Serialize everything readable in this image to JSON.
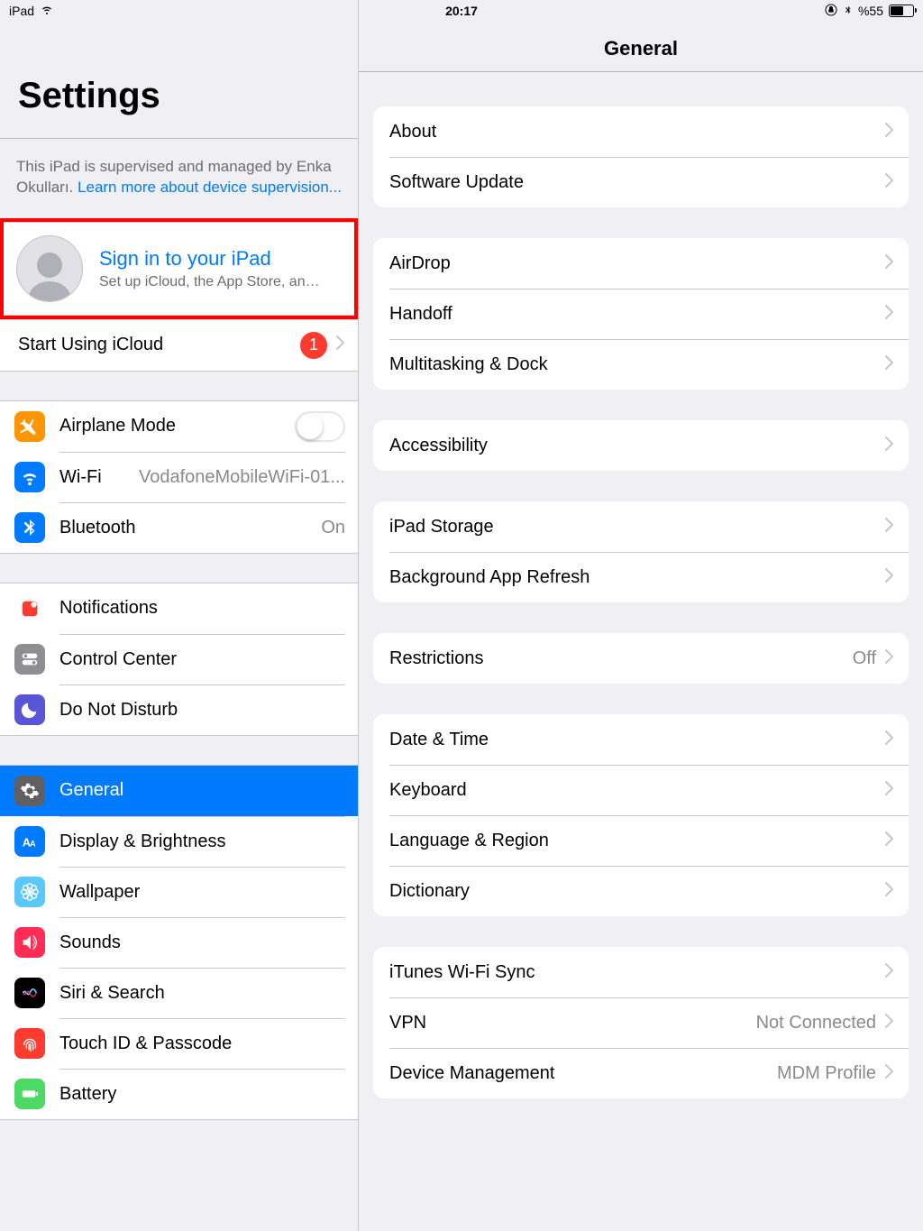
{
  "status": {
    "device": "iPad",
    "time": "20:17",
    "battery_text": "%55"
  },
  "sidebar": {
    "title": "Settings",
    "supervision_prefix": "This iPad is supervised and managed by Enka Okulları. ",
    "supervision_link": "Learn more about device supervision...",
    "signin": {
      "title": "Sign in to your iPad",
      "subtitle": "Set up iCloud, the App Store, and..."
    },
    "icloud": {
      "label": "Start Using iCloud",
      "badge": "1"
    },
    "airplane": {
      "label": "Airplane Mode"
    },
    "wifi": {
      "label": "Wi-Fi",
      "value": "VodafoneMobileWiFi-01..."
    },
    "bluetooth": {
      "label": "Bluetooth",
      "value": "On"
    },
    "notifications": {
      "label": "Notifications"
    },
    "controlcenter": {
      "label": "Control Center"
    },
    "dnd": {
      "label": "Do Not Disturb"
    },
    "general": {
      "label": "General"
    },
    "display": {
      "label": "Display & Brightness"
    },
    "wallpaper": {
      "label": "Wallpaper"
    },
    "sounds": {
      "label": "Sounds"
    },
    "siri": {
      "label": "Siri & Search"
    },
    "touchid": {
      "label": "Touch ID & Passcode"
    },
    "battery": {
      "label": "Battery"
    }
  },
  "detail": {
    "title": "General",
    "g1": {
      "about": "About",
      "software": "Software Update"
    },
    "g2": {
      "airdrop": "AirDrop",
      "handoff": "Handoff",
      "multitask": "Multitasking & Dock"
    },
    "g3": {
      "accessibility": "Accessibility"
    },
    "g4": {
      "storage": "iPad Storage",
      "refresh": "Background App Refresh"
    },
    "g5": {
      "restrictions": "Restrictions",
      "restrictions_val": "Off"
    },
    "g6": {
      "datetime": "Date & Time",
      "keyboard": "Keyboard",
      "language": "Language & Region",
      "dictionary": "Dictionary"
    },
    "g7": {
      "itunes": "iTunes Wi-Fi Sync",
      "vpn": "VPN",
      "vpn_val": "Not Connected",
      "dm": "Device Management",
      "dm_val": "MDM Profile"
    }
  }
}
